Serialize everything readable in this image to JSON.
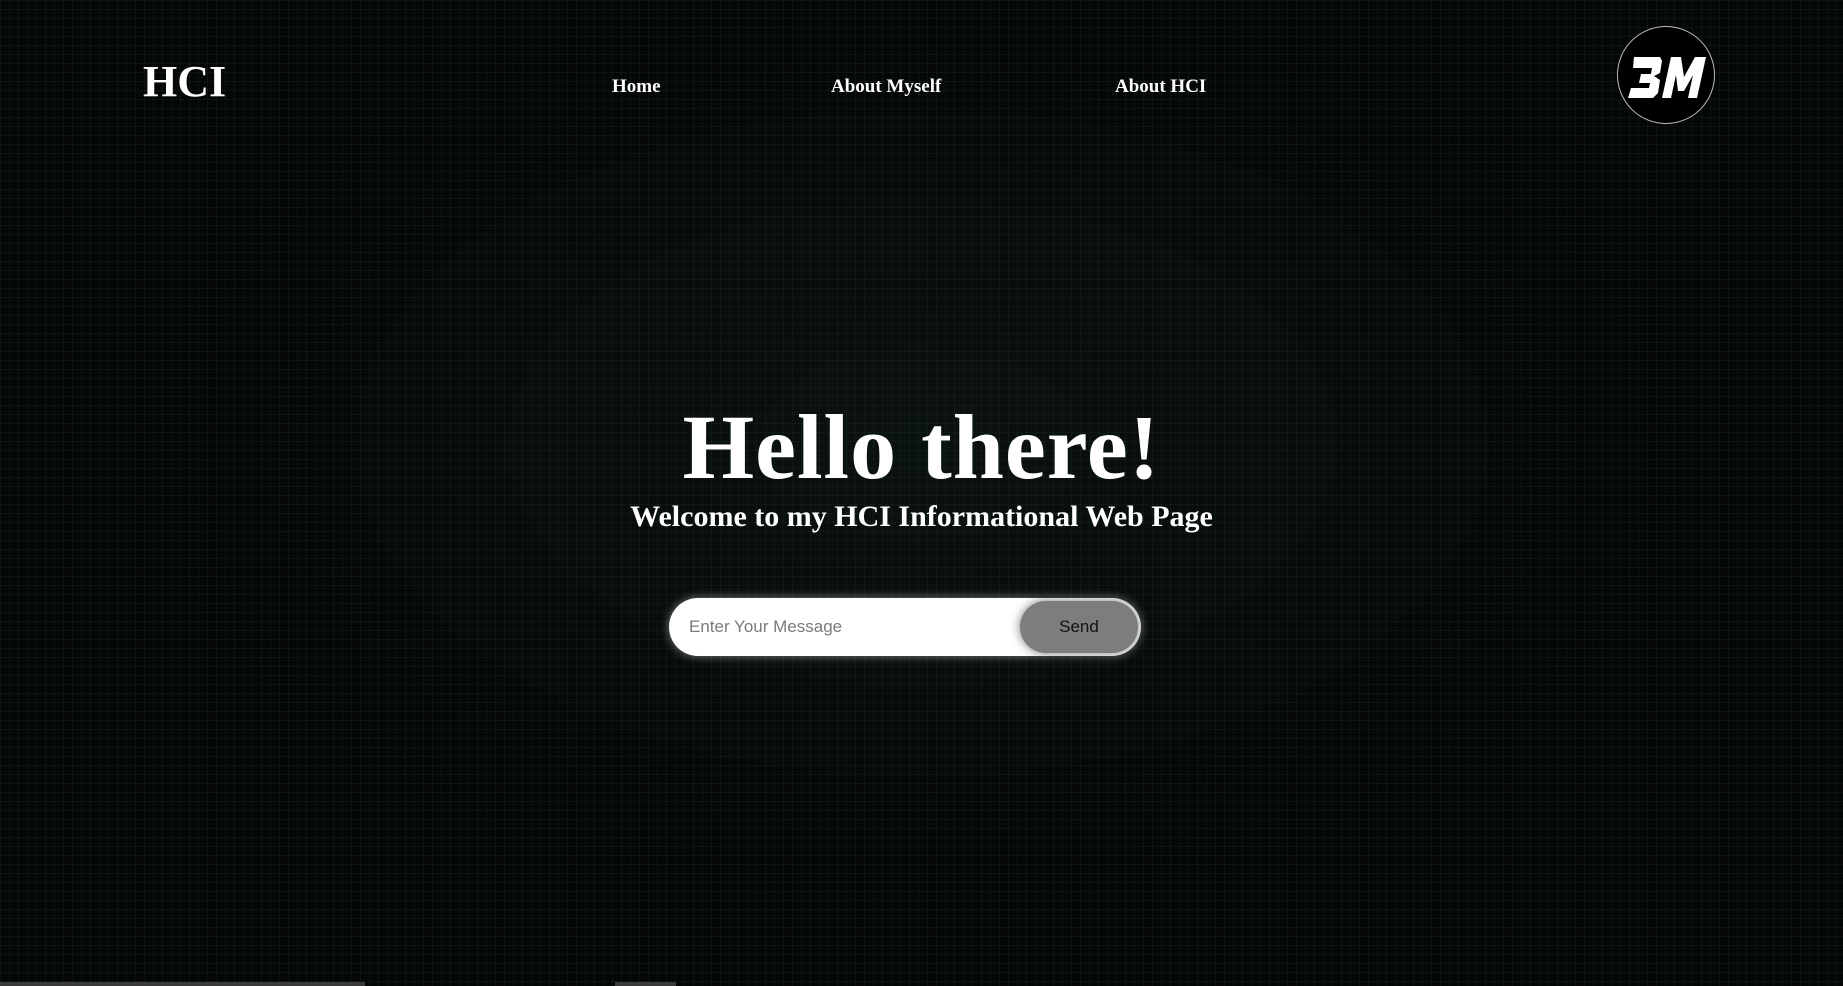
{
  "header": {
    "brand": "HCI",
    "nav": [
      {
        "label": "Home"
      },
      {
        "label": "About Myself"
      },
      {
        "label": "About HCI"
      }
    ],
    "logo_text": "3M"
  },
  "hero": {
    "title": "Hello there!",
    "subtitle": "Welcome to my HCI Informational Web Page"
  },
  "message_form": {
    "input_value": "",
    "input_placeholder": "Enter Your Message",
    "send_label": "Send"
  },
  "colors": {
    "background": "#050606",
    "grid": "#284f46",
    "text": "#ffffff",
    "send_button": "#7d7d7d",
    "input_background": "#ffffff"
  },
  "icons": {
    "logo": "3m-circle-logo"
  }
}
